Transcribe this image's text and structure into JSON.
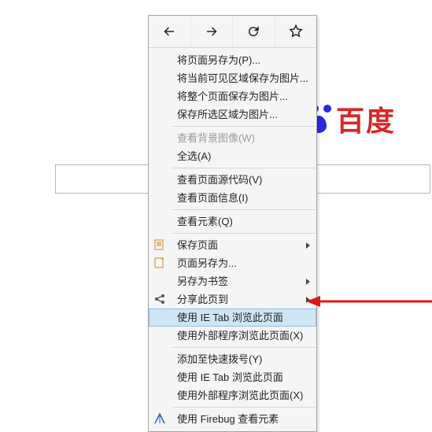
{
  "background": {
    "brand_text": "百度"
  },
  "menu": {
    "nav": {
      "back_icon": "back-icon",
      "forward_icon": "forward-icon",
      "reload_icon": "reload-icon",
      "bookmark_icon": "bookmark-icon"
    },
    "items": {
      "save_page_as": "将页面另存为(P)...",
      "save_visible_as_image": "将当前可见区域保存为图片...",
      "save_whole_page_as_image": "将整个页面保存为图片...",
      "save_selected_as_image": "保存所选区域为图片...",
      "view_bg_image": "查看背景图像(W)",
      "select_all": "全选(A)",
      "view_source": "查看页面源代码(V)",
      "view_page_info": "查看页面信息(I)",
      "inspect_element": "查看元素(Q)",
      "save_page": "保存页面",
      "save_page_as2": "页面另存为...",
      "save_as_bookmark": "另存为书签",
      "share_page_to": "分享此页到",
      "use_ietab": "使用 IE Tab 浏览此页面",
      "use_external": "使用外部程序浏览此页面(X)",
      "add_to_speed_dial": "添加至快速拨号(Y)",
      "use_ietab2": "使用 IE Tab 浏览此页面",
      "use_external2": "使用外部程序浏览此页面(X)",
      "use_firebug": "使用 Firebug 查看元素"
    }
  }
}
